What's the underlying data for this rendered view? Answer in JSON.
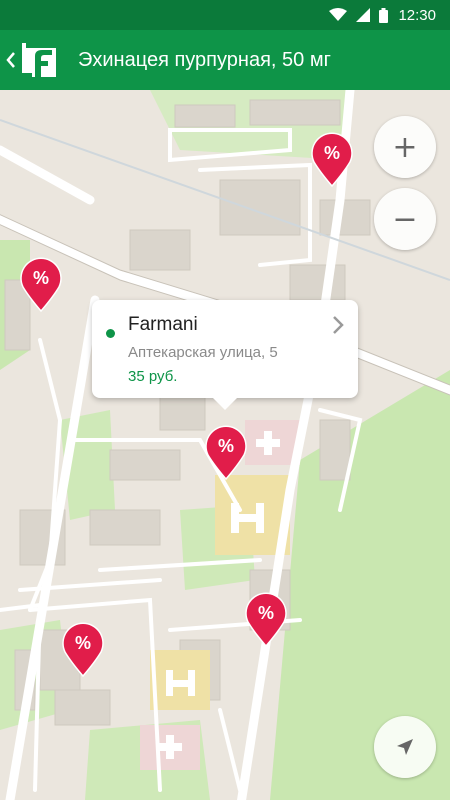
{
  "status_bar": {
    "time": "12:30",
    "icons": [
      "wifi-icon",
      "signal-icon",
      "battery-icon"
    ]
  },
  "app_bar": {
    "title": "Эхинацея пурпурная, 50 мг",
    "logo_letter": "f",
    "back_icon": "chevron-left-icon"
  },
  "map": {
    "controls": {
      "zoom_in": "+",
      "zoom_out": "−",
      "locate_icon": "navigation-arrow-icon"
    },
    "pins": [
      {
        "id": "pin-1",
        "symbol": "%"
      },
      {
        "id": "pin-2",
        "symbol": "%"
      },
      {
        "id": "pin-3",
        "symbol": "%"
      },
      {
        "id": "pin-4",
        "symbol": "%"
      },
      {
        "id": "pin-5",
        "symbol": "%"
      }
    ],
    "callout": {
      "name": "Farmani",
      "address": "Аптекарская улица, 5",
      "price": "35 руб."
    }
  },
  "colors": {
    "app_bar": "#0e9448",
    "status_bar": "#0b7a3a",
    "pin": "#e11d4a",
    "park": "#c9e7b0",
    "building": "#dcd7cf",
    "road": "#ffffff"
  }
}
